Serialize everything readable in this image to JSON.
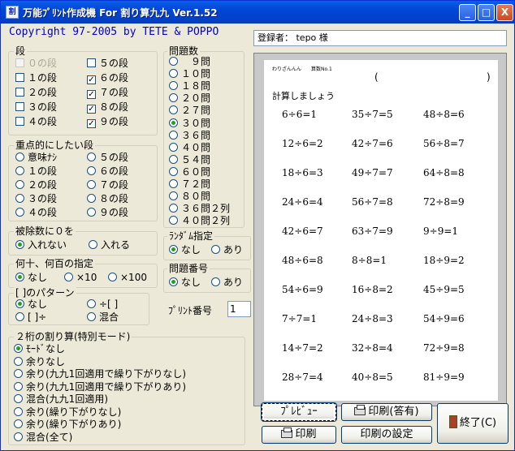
{
  "window": {
    "title": "万能ﾌﾟﾘﾝﾄ作成機 For 割り算九九 Ver.1.52",
    "app_icon": "wari-icon",
    "controls": {
      "minimize": "_",
      "maximize": "□",
      "close": "X"
    }
  },
  "copyright": "Copyright 97-2005 by TETE & POPPO",
  "registered": "登録者： tepo 様",
  "dan": {
    "legend": "段",
    "items": [
      {
        "label": "０の段",
        "checked": false,
        "disabled": true
      },
      {
        "label": "１の段",
        "checked": false
      },
      {
        "label": "２の段",
        "checked": false
      },
      {
        "label": "３の段",
        "checked": false
      },
      {
        "label": "４の段",
        "checked": false
      },
      {
        "label": "５の段",
        "checked": false
      },
      {
        "label": "６の段",
        "checked": true
      },
      {
        "label": "７の段",
        "checked": true
      },
      {
        "label": "８の段",
        "checked": true
      },
      {
        "label": "９の段",
        "checked": true
      }
    ]
  },
  "focus": {
    "legend": "重点的にしたい段",
    "items": [
      {
        "label": "意味ﾅｼ",
        "selected": false
      },
      {
        "label": "１の段",
        "selected": false
      },
      {
        "label": "２の段",
        "selected": false
      },
      {
        "label": "３の段",
        "selected": false
      },
      {
        "label": "４の段",
        "selected": false
      },
      {
        "label": "５の段",
        "selected": false
      },
      {
        "label": "６の段",
        "selected": false
      },
      {
        "label": "７の段",
        "selected": false
      },
      {
        "label": "８の段",
        "selected": false
      },
      {
        "label": "９の段",
        "selected": false
      }
    ]
  },
  "zero": {
    "legend": "被除数に０を",
    "items": [
      {
        "label": "入れない",
        "selected": true
      },
      {
        "label": "入れる",
        "selected": false
      }
    ]
  },
  "multiple": {
    "legend": "何十、何百の指定",
    "items": [
      {
        "label": "なし",
        "selected": true
      },
      {
        "label": "×10",
        "selected": false
      },
      {
        "label": "×100",
        "selected": false
      }
    ]
  },
  "pattern": {
    "legend": "[ ]のパターン",
    "items": [
      {
        "label": "なし",
        "selected": true
      },
      {
        "label": "[ ]÷",
        "selected": false
      },
      {
        "label": "÷[ ]",
        "selected": false
      },
      {
        "label": "混合",
        "selected": false
      }
    ]
  },
  "twodigit": {
    "legend": "２桁の割り算(特別モード)",
    "items": [
      {
        "label": "ﾓｰﾄﾞなし",
        "selected": true
      },
      {
        "label": "余りなし",
        "selected": false
      },
      {
        "label": "余り(九九1回適用で繰り下がりなし)",
        "selected": false
      },
      {
        "label": "余り(九九1回適用で繰り下がりあり)",
        "selected": false
      },
      {
        "label": "混合(九九1回適用)",
        "selected": false
      },
      {
        "label": "余り(繰り下がりなし)",
        "selected": false
      },
      {
        "label": "余り(繰り下がりあり)",
        "selected": false
      },
      {
        "label": "混合(全て)",
        "selected": false
      }
    ]
  },
  "count": {
    "legend": "問題数",
    "items": [
      {
        "label": "　９問",
        "selected": false
      },
      {
        "label": "１０問",
        "selected": false
      },
      {
        "label": "１８問",
        "selected": false
      },
      {
        "label": "２０問",
        "selected": false
      },
      {
        "label": "２７問",
        "selected": false
      },
      {
        "label": "３０問",
        "selected": true
      },
      {
        "label": "３６問",
        "selected": false
      },
      {
        "label": "４０問",
        "selected": false
      },
      {
        "label": "５４問",
        "selected": false
      },
      {
        "label": "６０問",
        "selected": false
      },
      {
        "label": "７２問",
        "selected": false
      },
      {
        "label": "８０問",
        "selected": false
      },
      {
        "label": "３６問２列",
        "selected": false
      },
      {
        "label": "４０問２列",
        "selected": false
      }
    ]
  },
  "random": {
    "legend": "ﾗﾝﾀﾞﾑ指定",
    "items": [
      {
        "label": "なし",
        "selected": true
      },
      {
        "label": "あり",
        "selected": false
      }
    ]
  },
  "numbering": {
    "legend": "問題番号",
    "items": [
      {
        "label": "なし",
        "selected": true
      },
      {
        "label": "あり",
        "selected": false
      }
    ]
  },
  "print_no": {
    "label": "ﾌﾟﾘﾝﾄ番号",
    "value": "1"
  },
  "preview": {
    "header_small": "わりざんんん　　算数No.1",
    "paren_open": "(",
    "paren_close": ")",
    "instruction": "計算しましょう",
    "problems": [
      [
        "6÷6=1",
        "35÷7=5",
        "48÷8=6"
      ],
      [
        "12÷6=2",
        "42÷7=6",
        "56÷8=7"
      ],
      [
        "18÷6=3",
        "49÷7=7",
        "64÷8=8"
      ],
      [
        "24÷6=4",
        "56÷7=8",
        "72÷8=9"
      ],
      [
        "42÷6=7",
        "63÷7=9",
        "9÷9=1"
      ],
      [
        "48÷6=8",
        "8÷8=1",
        "18÷9=2"
      ],
      [
        "54÷6=9",
        "16÷8=2",
        "45÷9=5"
      ],
      [
        "7÷7=1",
        "24÷8=3",
        "54÷9=6"
      ],
      [
        "14÷7=2",
        "32÷8=4",
        "72÷9=8"
      ],
      [
        "28÷7=4",
        "40÷8=5",
        "81÷9=9"
      ]
    ]
  },
  "buttons": {
    "preview": "ﾌﾟﾚﾋﾞｭｰ",
    "print_answer": "印刷(答有)",
    "print": "印刷",
    "print_settings": "印刷の設定",
    "exit": "終了(C)"
  }
}
